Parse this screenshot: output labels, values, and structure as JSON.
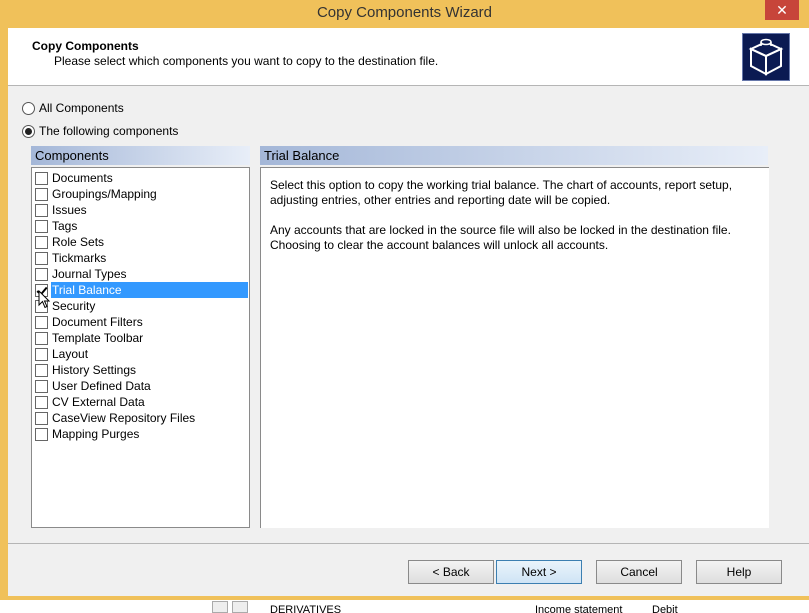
{
  "window": {
    "title": "Copy Components Wizard",
    "close_glyph": "✕"
  },
  "header": {
    "title": "Copy Components",
    "subtitle": "Please select which components you want to copy to the destination file."
  },
  "options": {
    "all_label": "All Components",
    "following_label": "The following components",
    "selected": "following"
  },
  "components": {
    "heading": "Components",
    "items": [
      {
        "label": "Documents",
        "checked": false,
        "selected": false
      },
      {
        "label": "Groupings/Mapping",
        "checked": false,
        "selected": false
      },
      {
        "label": "Issues",
        "checked": false,
        "selected": false
      },
      {
        "label": "Tags",
        "checked": false,
        "selected": false
      },
      {
        "label": "Role Sets",
        "checked": false,
        "selected": false
      },
      {
        "label": "Tickmarks",
        "checked": false,
        "selected": false
      },
      {
        "label": "Journal Types",
        "checked": false,
        "selected": false
      },
      {
        "label": "Trial Balance",
        "checked": true,
        "selected": true
      },
      {
        "label": "Security",
        "checked": false,
        "selected": false
      },
      {
        "label": "Document Filters",
        "checked": false,
        "selected": false
      },
      {
        "label": "Template Toolbar",
        "checked": false,
        "selected": false
      },
      {
        "label": "Layout",
        "checked": false,
        "selected": false
      },
      {
        "label": "History Settings",
        "checked": false,
        "selected": false
      },
      {
        "label": "User Defined Data",
        "checked": false,
        "selected": false
      },
      {
        "label": "CV External Data",
        "checked": false,
        "selected": false
      },
      {
        "label": "CaseView Repository Files",
        "checked": false,
        "selected": false
      },
      {
        "label": "Mapping Purges",
        "checked": false,
        "selected": false
      }
    ]
  },
  "detail": {
    "heading": "Trial Balance",
    "paragraphs": [
      "Select this option to copy the working trial balance. The chart of accounts, report setup, adjusting entries, other entries and reporting date will be copied.",
      "Any accounts that are locked in the source file will also be locked in the destination file. Choosing to clear the account balances will unlock all accounts."
    ]
  },
  "buttons": {
    "back": "< Back",
    "next": "Next >",
    "cancel": "Cancel",
    "help": "Help"
  },
  "background": {
    "row_text": "DERIVATIVES",
    "col2_text": "Income statement",
    "col3_text": "Debit"
  },
  "colors": {
    "title_bar": "#f0c15a",
    "close_button": "#c7453a",
    "selection": "#3399ff",
    "logo_bg": "#0b1a52"
  }
}
